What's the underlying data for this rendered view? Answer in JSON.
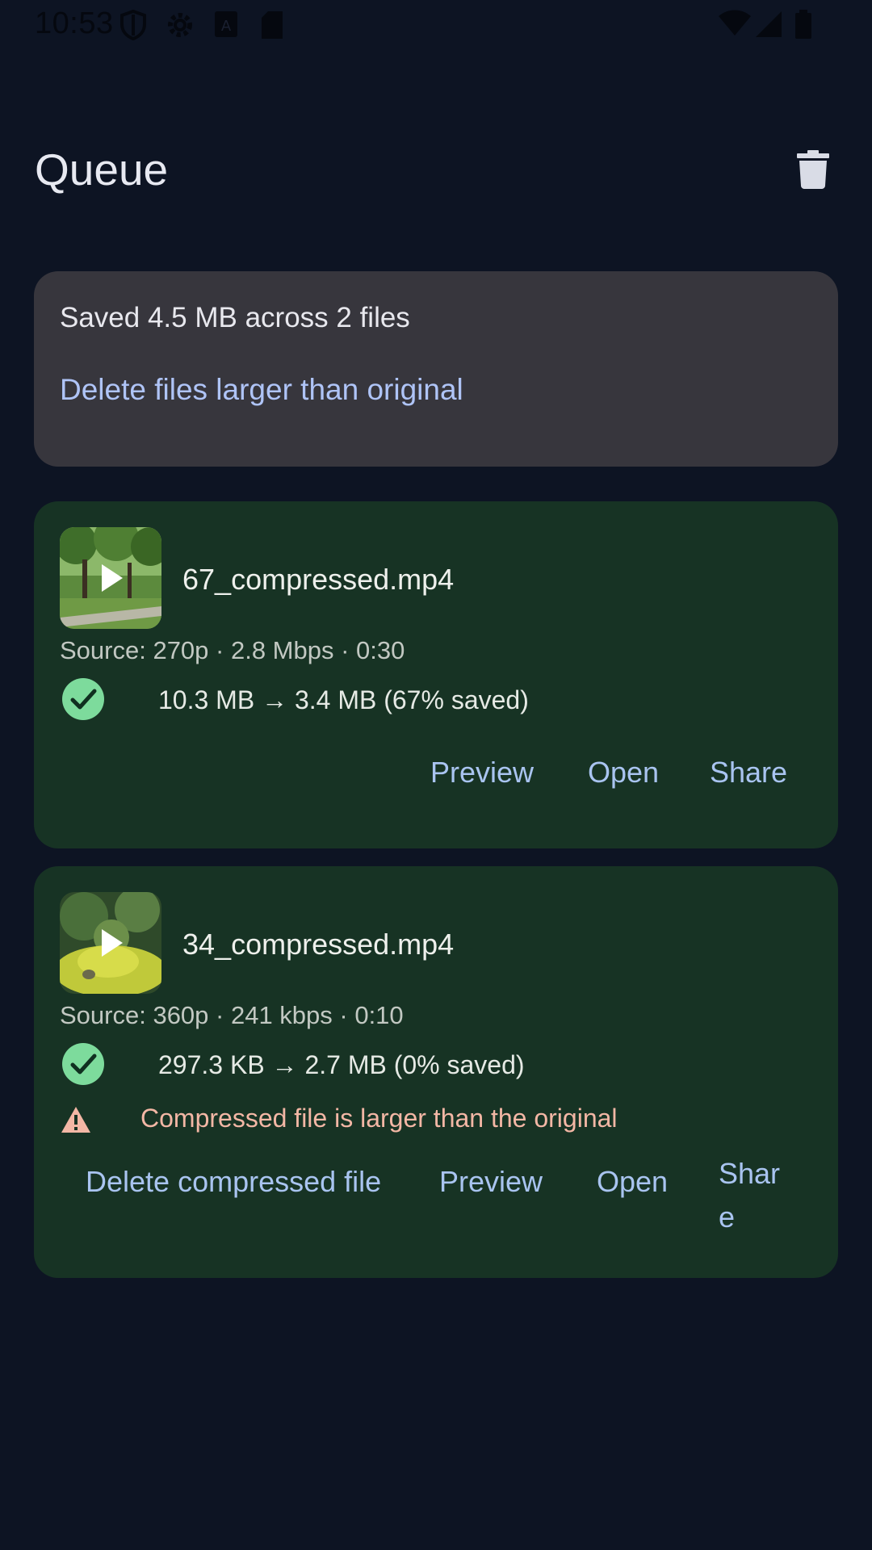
{
  "status_bar": {
    "time": "10:53",
    "icons_left": [
      "shield-icon",
      "gear-icon",
      "font-icon",
      "sd-card-icon"
    ],
    "icons_right": [
      "wifi-icon",
      "cellular-signal-icon",
      "battery-icon"
    ]
  },
  "header": {
    "title": "Queue",
    "action_icon": "delete-icon"
  },
  "summary": {
    "text": "Saved 4.5 MB across 2 files",
    "link": "Delete files larger than original"
  },
  "files": [
    {
      "name": "67_compressed.mp4",
      "meta": "Source: 270p · 2.8 Mbps · 0:30",
      "result": "10.3 MB → 3.4 MB (67% saved)",
      "status_icon": "check-circle-icon",
      "actions": [
        "Preview",
        "Open",
        "Share"
      ]
    },
    {
      "name": "34_compressed.mp4",
      "meta": "Source: 360p · 241 kbps · 0:10",
      "result": "297.3 KB → 2.7 MB (0% saved)",
      "status_icon": "check-circle-icon",
      "warning": "Compressed file is larger than the original",
      "warning_icon": "warning-icon",
      "actions": [
        "Delete compressed file",
        "Preview",
        "Open",
        "Share"
      ],
      "share_wrapped": [
        "Shar",
        "e"
      ]
    }
  ],
  "colors": {
    "background": "#0d1423",
    "summary_card": "#37363d",
    "file_card": "#173324",
    "link": "#afc4f7",
    "success": "#7ddb9c",
    "warning": "#f3b7a5"
  }
}
